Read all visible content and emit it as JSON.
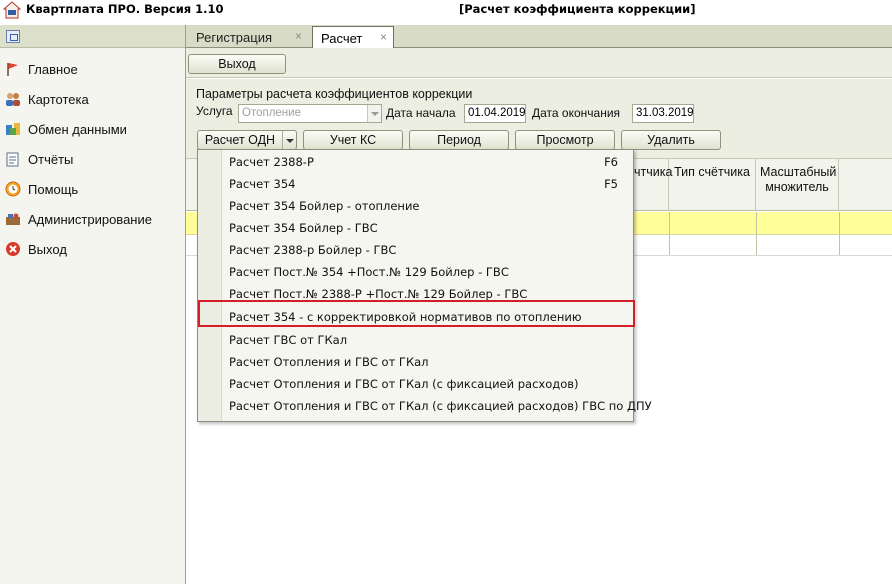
{
  "titlebar": {
    "app_title": "Квартплата ПРО.  Версия 1.10",
    "window_title": "[Расчет коэффициента коррекции]"
  },
  "sidebar": {
    "items": [
      {
        "label": "Главное",
        "icon": "flag-icon"
      },
      {
        "label": "Картотека",
        "icon": "people-icon"
      },
      {
        "label": "Обмен данными",
        "icon": "exchange-icon"
      },
      {
        "label": "Отчёты",
        "icon": "report-icon"
      },
      {
        "label": "Помощь",
        "icon": "help-clock-icon"
      },
      {
        "label": "Администрирование",
        "icon": "admin-icon"
      },
      {
        "label": "Выход",
        "icon": "exit-icon"
      }
    ]
  },
  "tabs": [
    {
      "label": "Регистрация",
      "close": "×"
    },
    {
      "label": "Расчет",
      "close": "×"
    }
  ],
  "toolbar": {
    "exit_label": "Выход"
  },
  "params": {
    "title": "Параметры расчета коэффициентов коррекции",
    "service_label": "Услуга",
    "service_value": "Отопление",
    "start_label": "Дата начала",
    "start_value": "01.04.2019",
    "end_label": "Дата окончания",
    "end_value": "31.03.2019"
  },
  "actions": {
    "calc_odn": "Расчет ОДН",
    "uchet_ks": "Учет КС",
    "period": "Период",
    "view": "Просмотр",
    "delete": "Удалить"
  },
  "grid": {
    "columns": [
      "чтчика",
      "Тип счётчика",
      "Масштабный множитель"
    ]
  },
  "menu": {
    "items": [
      {
        "label": "Расчет 2388-Р",
        "shortcut": "F6"
      },
      {
        "label": "Расчет 354",
        "shortcut": "F5"
      },
      {
        "label": "Расчет 354 Бойлер - отопление",
        "shortcut": ""
      },
      {
        "label": "Расчет 354 Бойлер - ГВС",
        "shortcut": ""
      },
      {
        "label": "Расчет 2388-р Бойлер - ГВС",
        "shortcut": ""
      },
      {
        "label": "Расчет Пост.№ 354 +Пост.№ 129 Бойлер - ГВС",
        "shortcut": ""
      },
      {
        "label": "Расчет Пост.№ 2388-Р +Пост.№ 129 Бойлер - ГВС",
        "shortcut": ""
      },
      {
        "label": "Расчет 354 - с корректировкой нормативов по отоплению",
        "shortcut": ""
      },
      {
        "label": "Расчет ГВС от ГКал",
        "shortcut": ""
      },
      {
        "label": "Расчет Отопления и ГВС от ГКал",
        "shortcut": ""
      },
      {
        "label": "Расчет Отопления и ГВС от ГКал (с фиксацией расходов)",
        "shortcut": ""
      },
      {
        "label": "Расчет Отопления и ГВС от ГКал (с фиксацией расходов) ГВС по ДПУ",
        "shortcut": ""
      }
    ]
  },
  "colors": {
    "highlight_border": "#d32027",
    "selected_row": "#ffff99",
    "panel_bg": "#eceee2"
  }
}
